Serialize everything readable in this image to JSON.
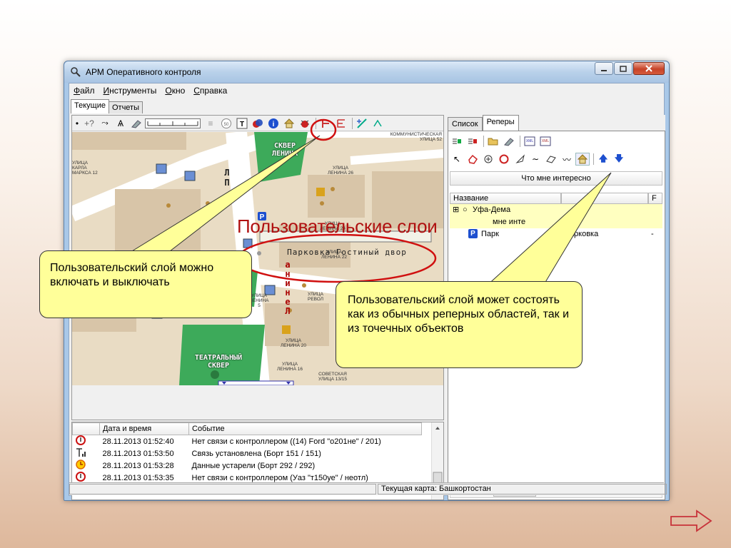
{
  "window": {
    "title": "АРМ Оперативного контроля"
  },
  "menu": {
    "items": [
      {
        "accel": "Ф",
        "rest": "айл"
      },
      {
        "accel": "И",
        "rest": "нструменты"
      },
      {
        "accel": "О",
        "rest": "кно"
      },
      {
        "accel": "С",
        "rest": "правка"
      }
    ]
  },
  "top_tabs": [
    "Текущие",
    "Отчеты"
  ],
  "map": {
    "ruler_text": "",
    "labels": {
      "sq_lenina": "СКВЕР ЛЕНИНА",
      "karla_marksa": "УЛИЦА КАРЛА МАРКСА 12",
      "lenina_26": "УЛИЦА ЛЕНИНА 26",
      "kommunist": "КОММУНИСТИЧЕСКАЯ УЛИЦА 52",
      "lenina_24": "УЛИЦА ЛЕНИНА 24",
      "lenina_22": "УЛИЦА ЛЕНИНА 22",
      "revol": "УЛИЦА РЕВОЛ",
      "lenina_5": "УЛИЦА ЛЕНИНА 5",
      "lenina_20": "УЛИЦА ЛЕНИНА 20",
      "lenina_16": "УЛИЦА ЛЕНИНА 16",
      "sovetskaya": "СОВЕТСКАЯ УЛИЦА 13/15",
      "teatr": "ТЕАТРАЛЬНЫЙ СКВЕР",
      "parking_label": "Парковка Гостиный двор",
      "vertical_street": "Л П",
      "vertical_street2": "а н и н е Л",
      "yl": "УЛ"
    }
  },
  "log": {
    "headers": [
      "Дата и время",
      "Событие"
    ],
    "rows": [
      {
        "icon": "no-signal-icon",
        "time": "28.11.2013 01:52:40",
        "event": "Нет связи с контроллером ((14) Ford \"о201не\" / 201)"
      },
      {
        "icon": "signal-icon",
        "time": "28.11.2013 01:53:50",
        "event": "Связь установлена (Борт 151 / 151)"
      },
      {
        "icon": "clock-icon",
        "time": "28.11.2013 01:53:28",
        "event": "Данные устарели (Борт 292 / 292)"
      },
      {
        "icon": "no-signal-icon",
        "time": "28.11.2013 01:53:35",
        "event": "Нет связи с контроллером (Уаз \"т150уе\" / неотл)"
      }
    ]
  },
  "right_panel": {
    "tabs": [
      "Список",
      "Реперы"
    ],
    "dropdown": "Что мне интересно",
    "tree_headers": [
      "Название",
      "",
      "F"
    ],
    "tree": [
      {
        "name": "Уфа-Дема",
        "type": "",
        "extra": ""
      },
      {
        "name": "мне инте",
        "type": "",
        "extra": ""
      },
      {
        "name": "Парк",
        "type": "Парковка",
        "extra": "-"
      }
    ],
    "scroll_grip": "III"
  },
  "status": {
    "current_map": "Текущая карта: Башкортостан"
  },
  "overlay": {
    "caption": "Пользовательские слои",
    "callout_left": "Пользовательский слой можно включать и выключать",
    "callout_right": "Пользовательский слой может состоять как из обычных реперных областей, так и из точечных объектов"
  },
  "colors": {
    "callout_fill": "#ffff99",
    "caption_red": "#b01010",
    "map_green": "#3daa5a",
    "map_ground": "#e9dcc4",
    "highlight_row": "#ffffc0"
  }
}
